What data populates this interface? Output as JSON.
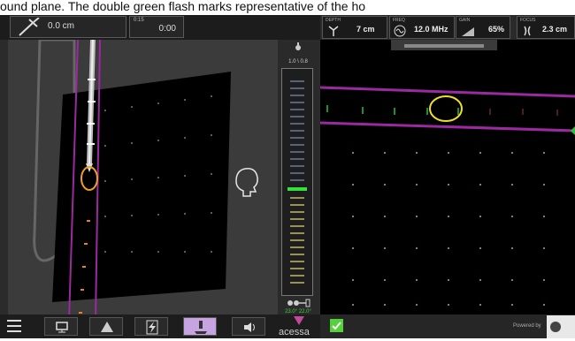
{
  "caption": "ound plane. The double green flash marks representative of the ho",
  "left": {
    "needle_depth": "0.0 cm",
    "timer_small": "0:15",
    "timer": "0:00",
    "gauge_ratio": "1.0 \\ 0.8",
    "angles": "23.0°  22.0°"
  },
  "ultrasound": {
    "depth_label": "DEPTH",
    "depth_value": "7 cm",
    "freq_label": "FREQ",
    "freq_value": "12.0 MHz",
    "gain_label": "GAIN",
    "gain_value": "65%",
    "focus_label": "FOCUS",
    "focus_value": "2.3 cm"
  },
  "bottom": {
    "brand": "acessa",
    "powered": "Powered by"
  },
  "colors": {
    "accent": "#c8a3e2",
    "green": "#55d13c",
    "purple": "#9b2aa0",
    "yellow": "#f0e020",
    "orange": "#f0a020"
  },
  "icons": {
    "needle": "needle-icon",
    "menu": "menu-icon",
    "check": "check-icon",
    "head": "head-profile-icon"
  }
}
